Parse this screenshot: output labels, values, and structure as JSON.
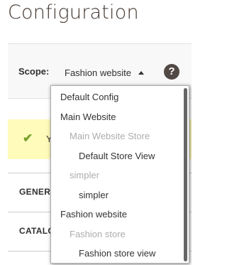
{
  "page": {
    "title": "Configuration"
  },
  "scope": {
    "label": "Scope:",
    "current": "Fashion website",
    "help_symbol": "?",
    "caret_icon": "caret-up-icon",
    "help_icon": "question-mark-icon"
  },
  "message": {
    "icon": "checkmark-icon",
    "text": "Y"
  },
  "sections": [
    "GENER",
    "CATALO",
    ""
  ],
  "dropdown": {
    "items": [
      {
        "label": "Default Config",
        "level": 0
      },
      {
        "label": "Main Website",
        "level": 0
      },
      {
        "label": "Main Website Store",
        "level": 1
      },
      {
        "label": "Default Store View",
        "level": 2
      },
      {
        "label": "simpler",
        "level": 1
      },
      {
        "label": "simpler",
        "level": 2
      },
      {
        "label": "Fashion website",
        "level": 0
      },
      {
        "label": "Fashion store",
        "level": 1
      },
      {
        "label": "Fashion store view",
        "level": 2
      }
    ]
  },
  "colors": {
    "message_bg": "#fffbbb",
    "check": "#79a22e",
    "help_bg": "#514943",
    "group_text": "#adadad"
  }
}
